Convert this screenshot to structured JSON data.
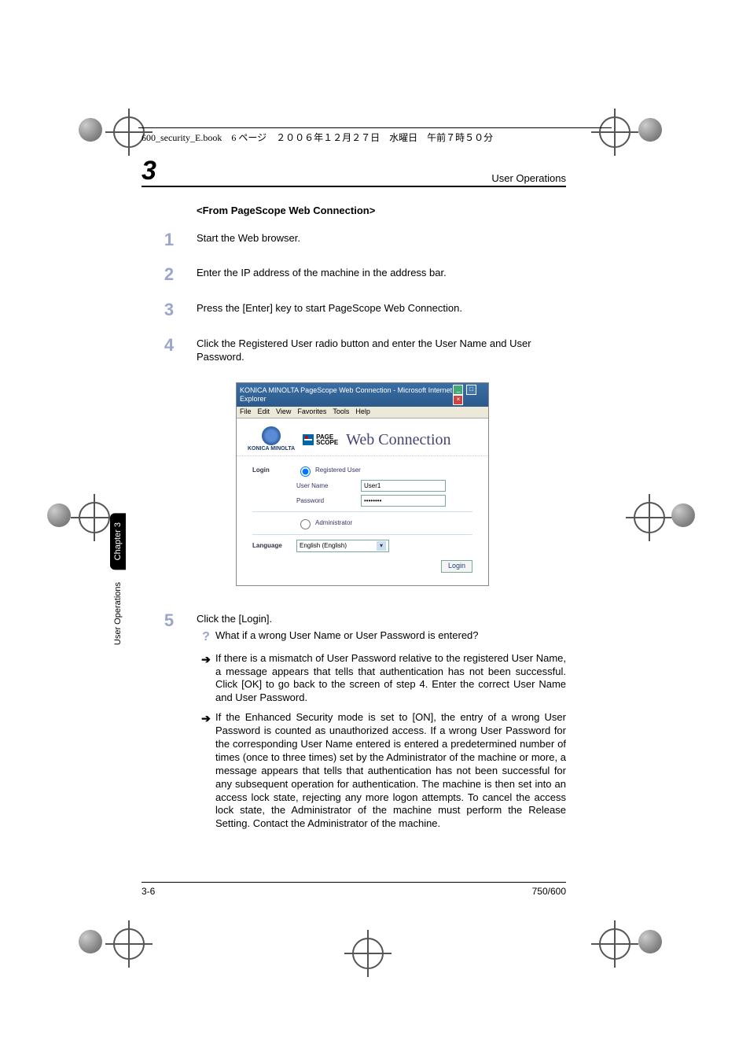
{
  "top_header": "600_security_E.book　6 ページ　２００６年１２月２７日　水曜日　午前７時５０分",
  "runner": {
    "number": "3",
    "title": "User Operations"
  },
  "side": {
    "chapter": "Chapter 3",
    "section": "User Operations"
  },
  "section_title": "<From PageScope Web Connection>",
  "steps": {
    "s1": {
      "num": "1",
      "text": "Start the Web browser."
    },
    "s2": {
      "num": "2",
      "text": "Enter the IP address of the machine in the address bar."
    },
    "s3": {
      "num": "3",
      "text": "Press the [Enter] key to start PageScope Web Connection."
    },
    "s4": {
      "num": "4",
      "text": "Click the Registered User radio button and enter the User Name and User Password."
    },
    "s5": {
      "num": "5",
      "text": "Click the [Login].",
      "q": "What if a wrong User Name or User Password is entered?",
      "a1": "If there is a mismatch of User Password relative to the registered User Name, a message appears that tells that authentication has not been successful. Click [OK] to go back to the screen of step 4. Enter the correct User Name and User Password.",
      "a2": "If the Enhanced Security mode is set to [ON], the entry of a wrong User Password is counted as unauthorized access. If a wrong User Password for the corresponding User Name entered is entered a predetermined number of times (once to three times) set by the Administrator of the machine or more, a message appears that tells that authentication has not been successful for any subsequent operation for authentication. The machine is then set into an access lock state, rejecting any more logon attempts. To cancel the access lock state, the Administrator of the machine must perform the Release Setting. Contact the Administrator of the machine."
    }
  },
  "figure": {
    "wintitle": "KONICA MINOLTA PageScope Web Connection - Microsoft Internet Explorer",
    "menu": {
      "file": "File",
      "edit": "Edit",
      "view": "View",
      "fav": "Favorites",
      "tools": "Tools",
      "help": "Help"
    },
    "brand": {
      "km": "KONICA MINOLTA",
      "ps1": "PAGE",
      "ps2": "SCOPE",
      "wc": "Web Connection"
    },
    "form": {
      "login_label": "Login",
      "reg_user": "Registered User",
      "uname_label": "User Name",
      "uname_value": "User1",
      "pwd_label": "Password",
      "pwd_value": "••••••••",
      "admin": "Administrator",
      "lang_label": "Language",
      "lang_value": "English (English)",
      "login_btn": "Login"
    }
  },
  "footer": {
    "left": "3-6",
    "right": "750/600"
  }
}
